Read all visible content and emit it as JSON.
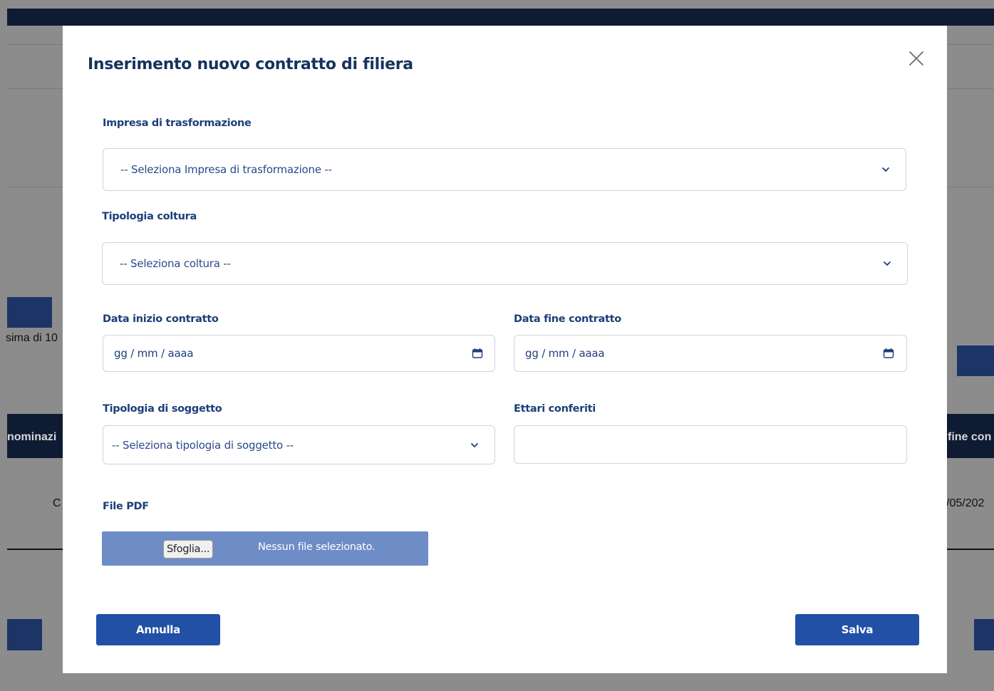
{
  "background": {
    "left_text_1": "sima di 10",
    "header_left": "nominazi",
    "header_right": "fine con",
    "row_left": "C",
    "row_right": "/05/202"
  },
  "modal": {
    "title": "Inserimento nuovo contratto di filiera",
    "close_icon": "close-icon",
    "impresa": {
      "label": "Impresa di trasformazione",
      "placeholder": "-- Seleziona Impresa di trasformazione --"
    },
    "coltura": {
      "label": "Tipologia coltura",
      "placeholder": "-- Seleziona coltura --"
    },
    "data_inizio": {
      "label": "Data inizio contratto",
      "placeholder": "gg / mm / aaaa"
    },
    "data_fine": {
      "label": "Data fine contratto",
      "placeholder": "gg / mm / aaaa"
    },
    "soggetto": {
      "label": "Tipologia di soggetto",
      "placeholder": "-- Seleziona tipologia di soggetto --"
    },
    "ettari": {
      "label": "Ettari conferiti",
      "value": ""
    },
    "file_pdf": {
      "label": "File PDF",
      "button": "Sfoglia...",
      "status": "Nessun file selezionato."
    },
    "cancel_label": "Annulla",
    "save_label": "Salva"
  },
  "colors": {
    "primary": "#2150a6",
    "label": "#1d3f7a",
    "title": "#17325e",
    "file_bar": "#6e8cc6"
  }
}
